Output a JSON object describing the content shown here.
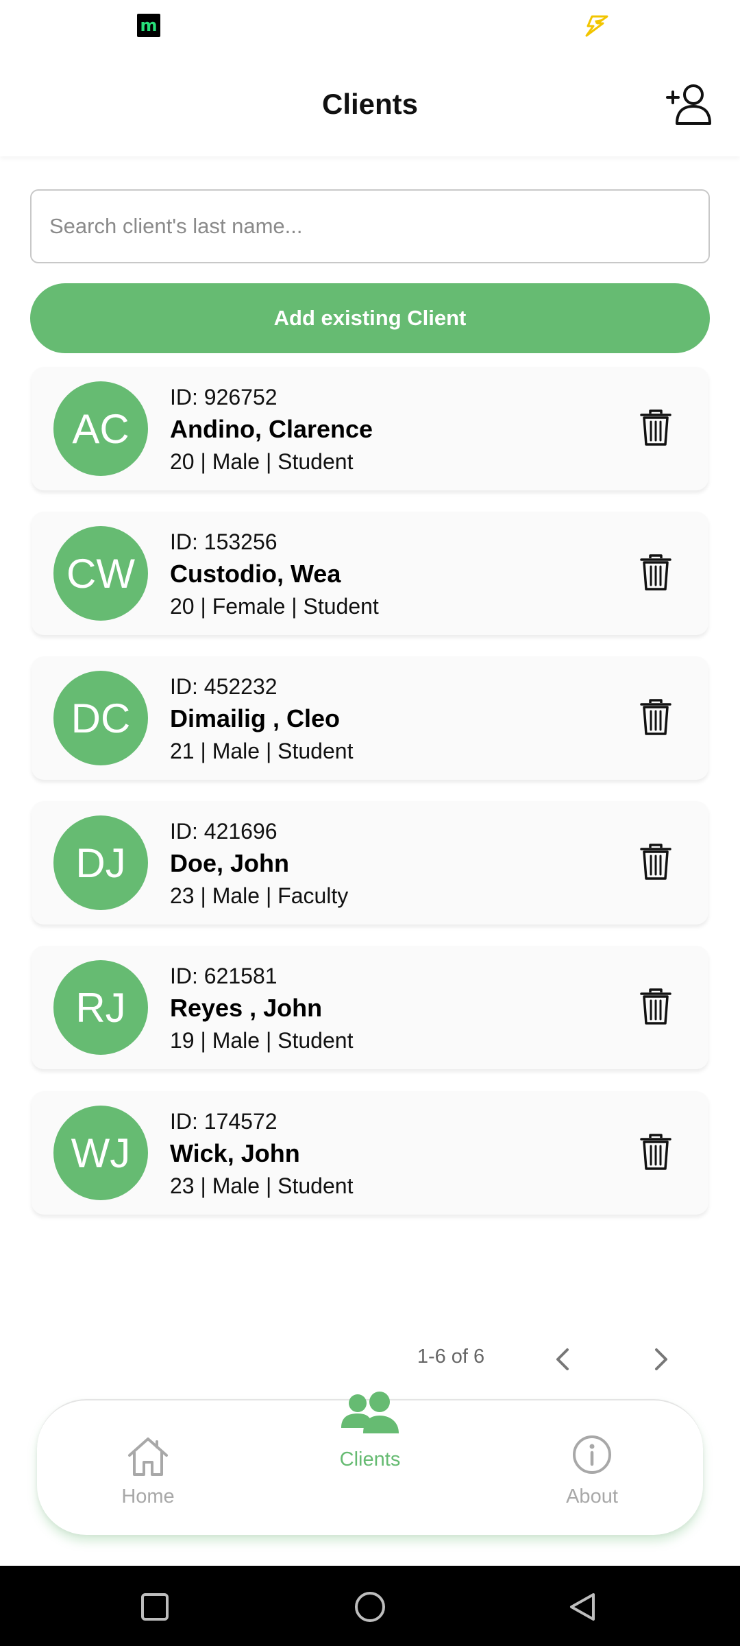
{
  "header": {
    "title": "Clients"
  },
  "search": {
    "placeholder": "Search client's last name...",
    "value": ""
  },
  "add_existing_label": "Add existing Client",
  "clients": [
    {
      "initials": "AC",
      "id": "ID: 926752",
      "name": "Andino, Clarence",
      "details": "20 | Male | Student"
    },
    {
      "initials": "CW",
      "id": "ID: 153256",
      "name": "Custodio, Wea",
      "details": "20 | Female | Student"
    },
    {
      "initials": "DC",
      "id": "ID: 452232",
      "name": "Dimailig , Cleo",
      "details": "21 | Male | Student"
    },
    {
      "initials": "DJ",
      "id": "ID: 421696",
      "name": "Doe, John",
      "details": "23 | Male | Faculty"
    },
    {
      "initials": "RJ",
      "id": "ID: 621581",
      "name": "Reyes , John",
      "details": "19 | Male | Student"
    },
    {
      "initials": "WJ",
      "id": "ID: 174572",
      "name": "Wick, John",
      "details": "23 | Male | Student"
    }
  ],
  "pagination": {
    "range_label": "1-6 of 6"
  },
  "nav": {
    "home_label": "Home",
    "clients_label": "Clients",
    "about_label": "About",
    "active": "clients"
  },
  "status_bar": {
    "app_icon_letter": "m"
  },
  "colors": {
    "accent": "#66bb72",
    "accent_text": "#ffffff",
    "inactive": "#a8a8a8"
  },
  "icons": {
    "header_action": "add-user-icon",
    "delete": "trash-icon",
    "home": "home-icon",
    "clients": "users-icon",
    "about": "info-icon"
  }
}
